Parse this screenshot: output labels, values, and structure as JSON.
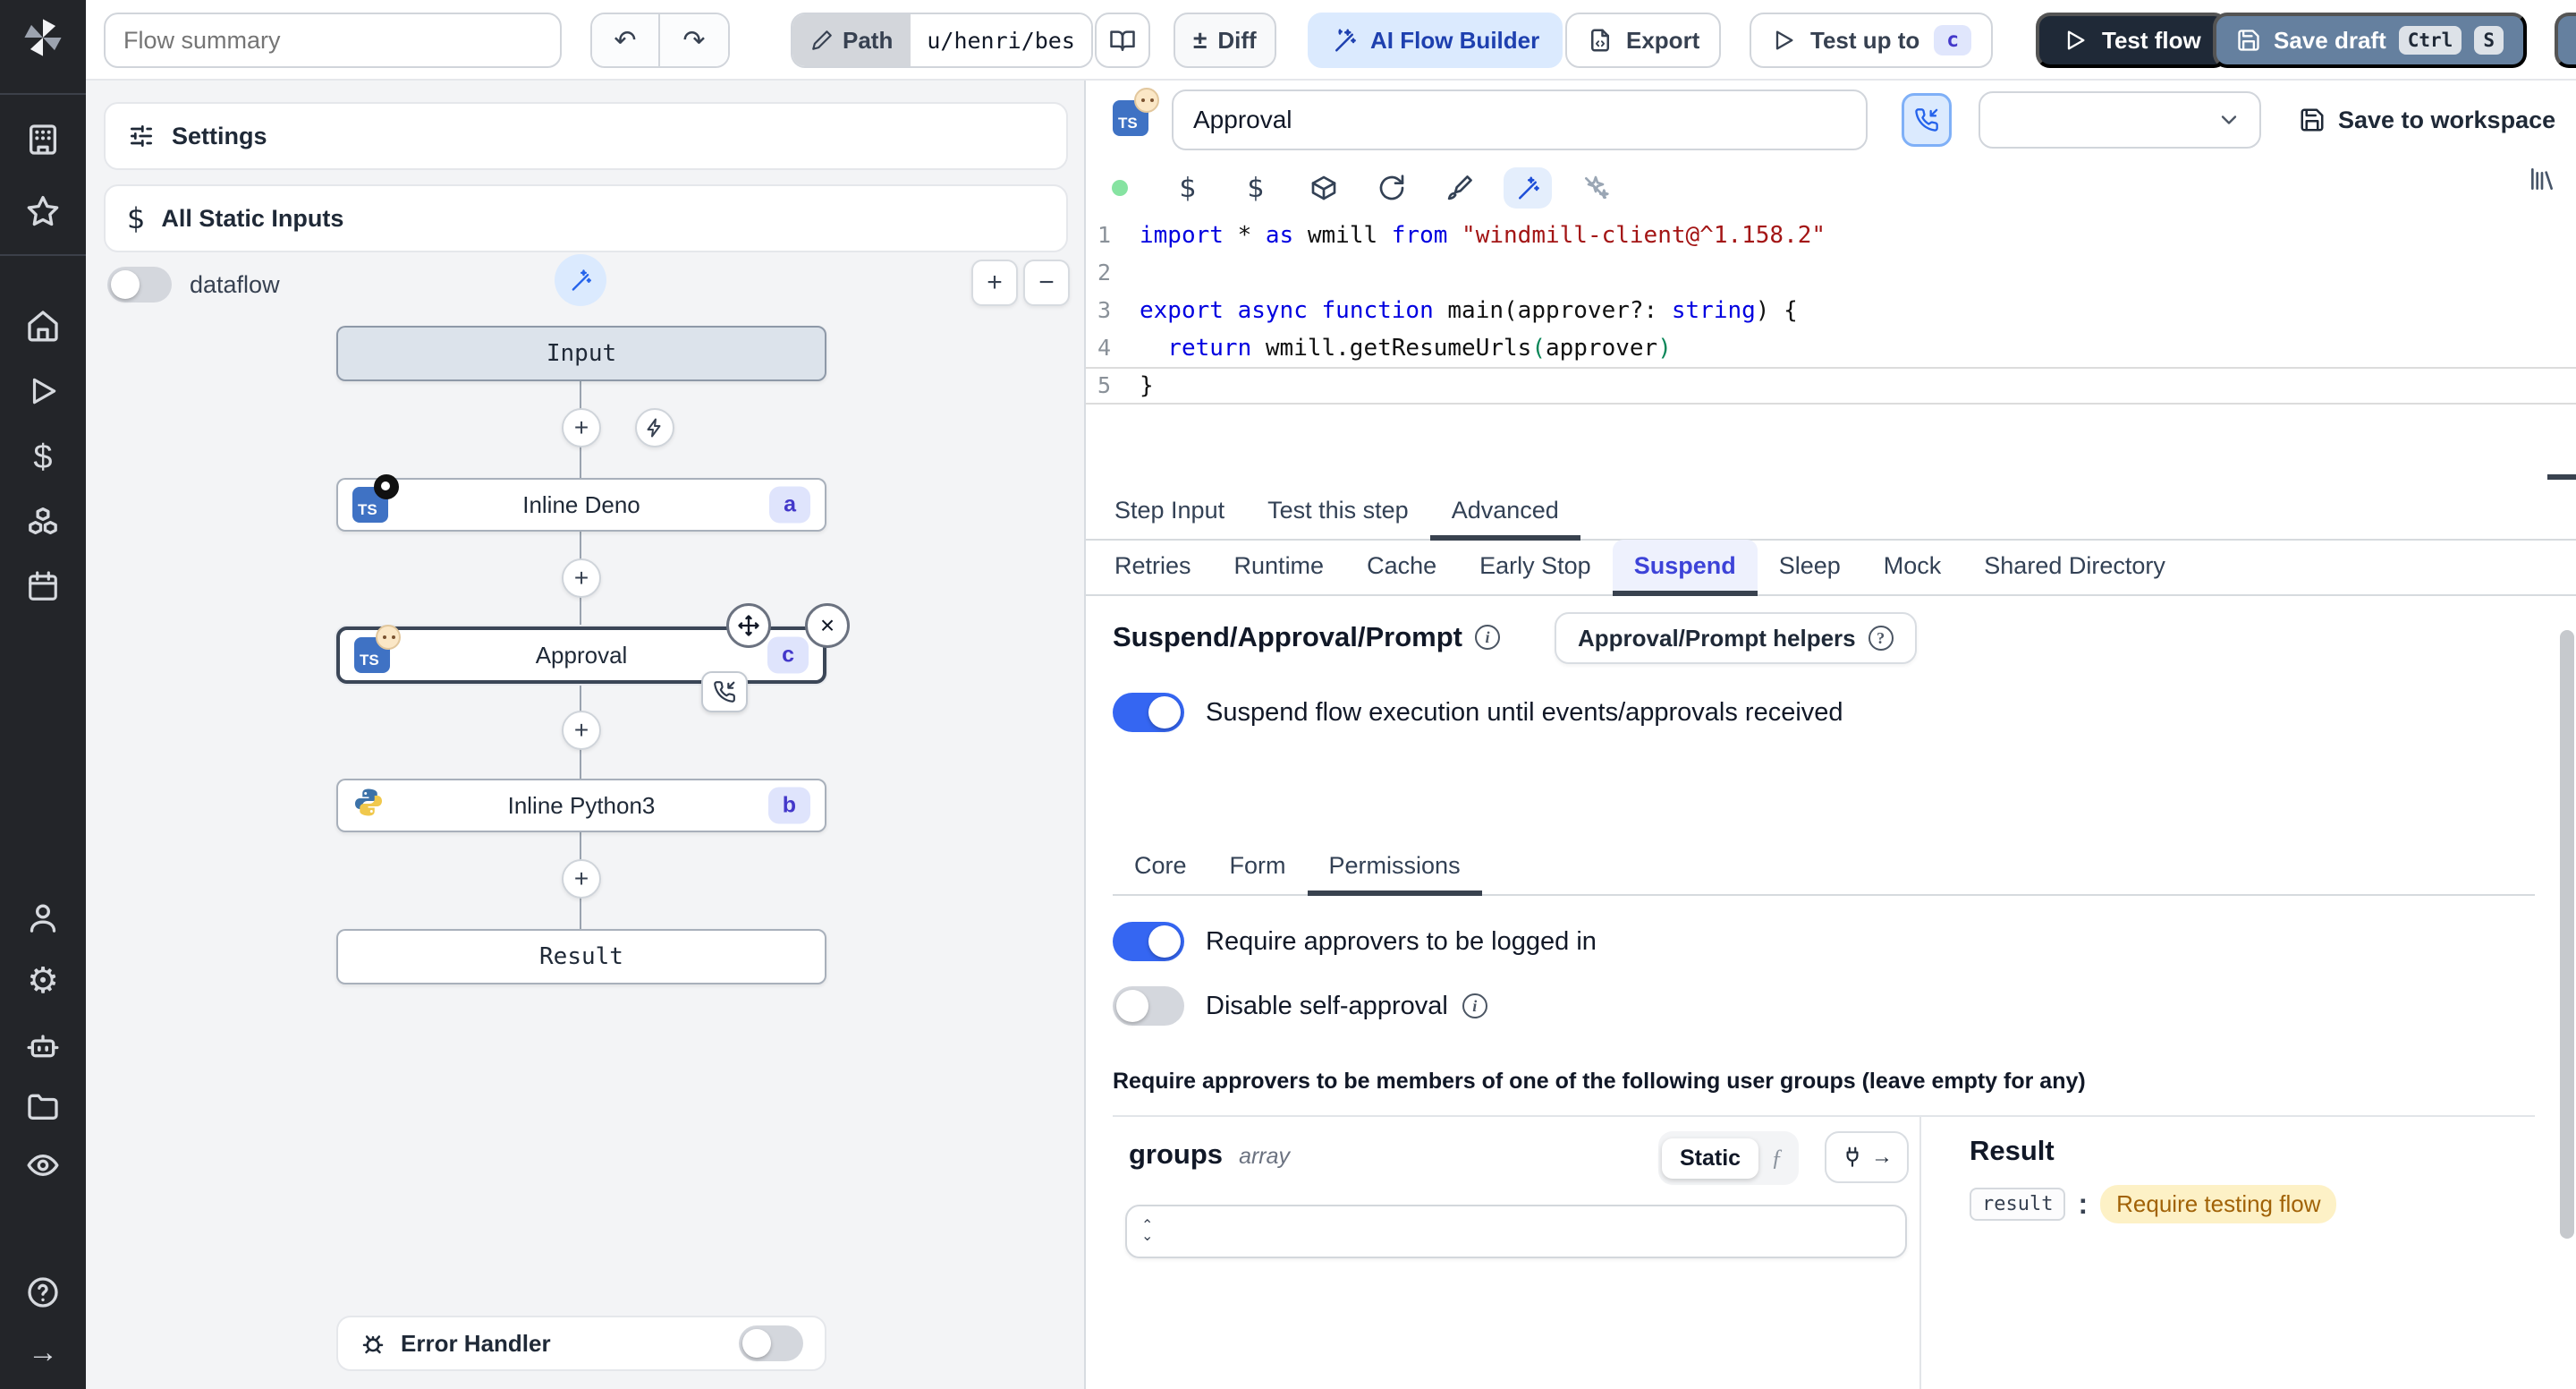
{
  "topbar": {
    "flow_summary_placeholder": "Flow summary",
    "path_label": "Path",
    "path_value": "u/henri/bes",
    "diff_label": "Diff",
    "diff_symbol": "±",
    "ai_flow_builder_label": "AI Flow Builder",
    "export_label": "Export",
    "test_up_to_label": "Test up to",
    "test_up_to_badge": "c",
    "test_flow_label": "Test flow",
    "save_draft_label": "Save draft",
    "kbd_ctrl": "Ctrl",
    "kbd_s": "S",
    "undo_glyph": "↶",
    "redo_glyph": "↷"
  },
  "flow_panel": {
    "settings_label": "Settings",
    "all_static_inputs_label": "All Static Inputs",
    "dataflow_label": "dataflow",
    "zoom_in_glyph": "+",
    "zoom_out_glyph": "−",
    "plus_glyph": "+",
    "close_glyph": "×",
    "nodes": {
      "input_label": "Input",
      "deno_label": "Inline Deno",
      "deno_badge": "a",
      "deno_lang": "TS",
      "approval_label": "Approval",
      "approval_badge": "c",
      "approval_lang": "TS",
      "python_label": "Inline Python3",
      "python_badge": "b",
      "result_label": "Result"
    },
    "error_handler_label": "Error Handler"
  },
  "step_editor": {
    "lang_badge": "TS",
    "title_value": "Approval",
    "save_to_workspace_label": "Save to workspace",
    "code": {
      "numbers": [
        "1",
        "2",
        "3",
        "4",
        "5"
      ],
      "l1": {
        "k1": "import",
        "p1": " * ",
        "k2": "as",
        "p2": " wmill ",
        "k3": "from",
        "s1": " \"windmill-client@^1.158.2\""
      },
      "l3": {
        "k1": "export",
        "p1": " ",
        "k2": "async",
        "p2": " ",
        "k3": "function",
        "p3": " main(approver?: ",
        "k4": "string",
        "p4": ") {"
      },
      "l4": {
        "k1": "  return",
        "p1": " wmill.getResumeUrls",
        "g1": "(",
        "p2": "approver",
        "g2": ")"
      },
      "l5": {
        "p1": "}"
      }
    }
  },
  "tabs": {
    "step": [
      "Step Input",
      "Test this step",
      "Advanced"
    ],
    "advanced": [
      "Retries",
      "Runtime",
      "Cache",
      "Early Stop",
      "Suspend",
      "Sleep",
      "Mock",
      "Shared Directory"
    ],
    "permissions": [
      "Core",
      "Form",
      "Permissions"
    ]
  },
  "suspend": {
    "heading": "Suspend/Approval/Prompt",
    "helpers_button_label": "Approval/Prompt helpers",
    "suspend_toggle_label": "Suspend flow execution until events/approvals received",
    "require_login_label": "Require approvers to be logged in",
    "disable_self_approval_label": "Disable self-approval",
    "groups_note": "Require approvers to be members of one of the following user groups (leave empty for any)",
    "groups_field_name": "groups",
    "groups_field_type": "array",
    "static_label": "Static"
  },
  "result_panel": {
    "title": "Result",
    "key": "result",
    "value": "Require testing flow"
  },
  "colors": {
    "accent_blue": "#3566f2",
    "dark_button": "#1f2937",
    "save_draft_button": "#65809f",
    "node_badge_bg": "#dfe4fc",
    "node_badge_text": "#4338ca",
    "result_badge_bg": "#fdf1c6",
    "result_badge_text": "#a16207",
    "selected_node_border": "#3b4657",
    "ai_button_bg": "#dbeafe"
  }
}
